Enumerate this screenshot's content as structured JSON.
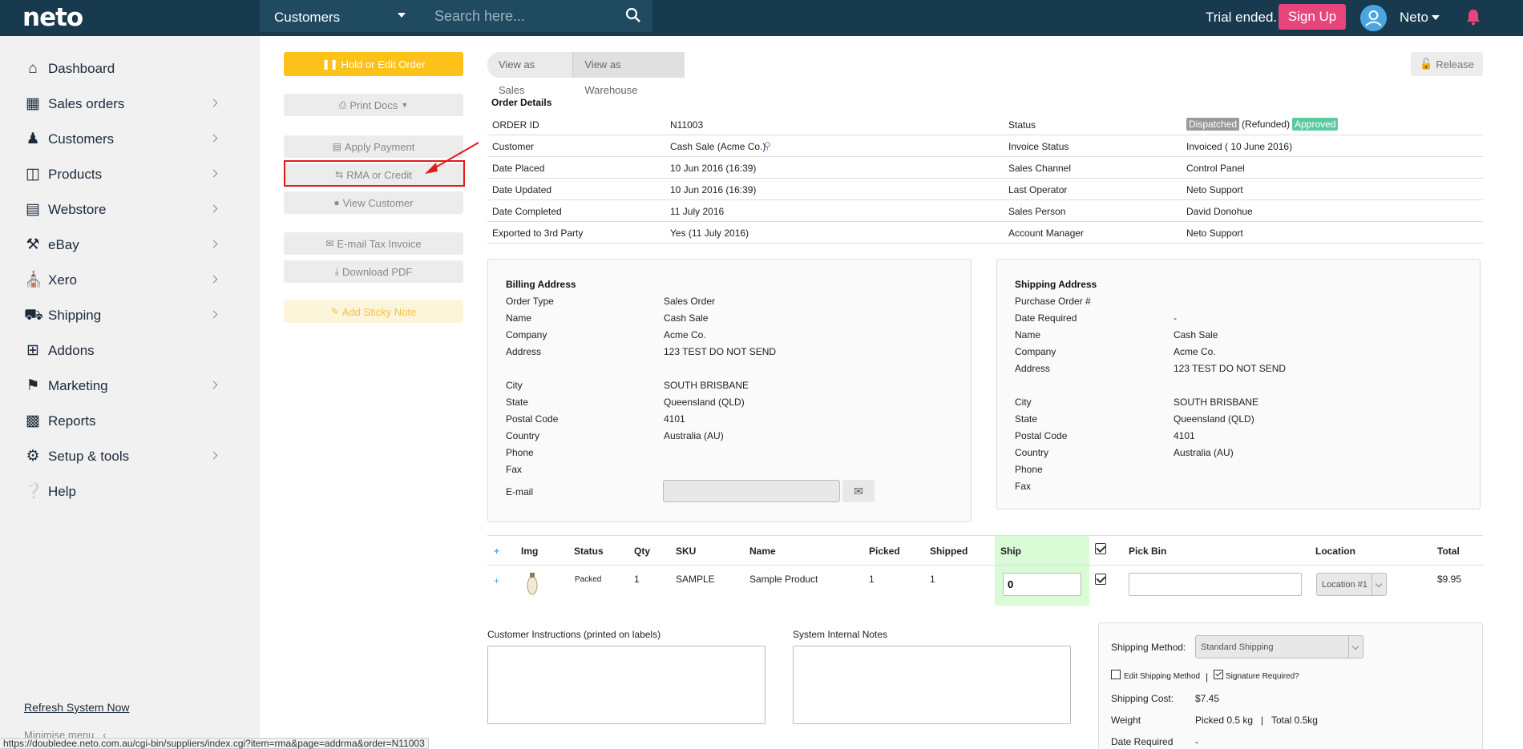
{
  "topbar": {
    "logo": "neto",
    "search_scope": "Customers",
    "search_placeholder": "Search here...",
    "trial": "Trial ended.",
    "signup": "Sign Up",
    "user": "Neto"
  },
  "sidebar": {
    "items": [
      {
        "label": "Dashboard",
        "icon": "home-icon"
      },
      {
        "label": "Sales orders",
        "icon": "document-icon"
      },
      {
        "label": "Customers",
        "icon": "users-icon"
      },
      {
        "label": "Products",
        "icon": "box-icon"
      },
      {
        "label": "Webstore",
        "icon": "browser-icon"
      },
      {
        "label": "eBay",
        "icon": "gavel-icon"
      },
      {
        "label": "Xero",
        "icon": "bank-icon"
      },
      {
        "label": "Shipping",
        "icon": "truck-icon"
      },
      {
        "label": "Addons",
        "icon": "plus-square-icon"
      },
      {
        "label": "Marketing",
        "icon": "tag-icon"
      },
      {
        "label": "Reports",
        "icon": "chart-icon"
      },
      {
        "label": "Setup & tools",
        "icon": "gear-icon"
      },
      {
        "label": "Help",
        "icon": "help-icon"
      }
    ],
    "refresh": "Refresh System Now",
    "minimise": "Minimise menu"
  },
  "status_url": "https://doubledee.neto.com.au/cgi-bin/suppliers/index.cgi?item=rma&page=addrma&order=N11003",
  "actions": {
    "hold": "Hold or Edit Order",
    "print": "Print Docs",
    "apply_payment": "Apply Payment",
    "rma": "RMA or Credit",
    "view_customer": "View Customer",
    "email_invoice": "E-mail Tax Invoice",
    "download_pdf": "Download PDF",
    "sticky": "Add Sticky Note"
  },
  "view_toggle": {
    "sales": "View as Sales",
    "warehouse": "View as Warehouse"
  },
  "release": "Release",
  "order_details": {
    "title": "Order Details",
    "rows": [
      {
        "label": "ORDER ID",
        "value": "N11003",
        "label2": "Status",
        "value2": ""
      },
      {
        "label": "Customer",
        "value": "Cash Sale (Acme Co.)",
        "label2": "Invoice Status",
        "value2": "Invoiced ( 10 June 2016)"
      },
      {
        "label": "Date Placed",
        "value": "10 Jun 2016 (16:39)",
        "label2": "Sales Channel",
        "value2": "Control Panel"
      },
      {
        "label": "Date Updated",
        "value": "10 Jun 2016 (16:39)",
        "label2": "Last Operator",
        "value2": "Neto Support"
      },
      {
        "label": "Date Completed",
        "value": "11 July 2016",
        "label2": "Sales Person",
        "value2": "David Donohue"
      },
      {
        "label": "Exported to 3rd Party",
        "value": "Yes (11 July 2016)",
        "label2": "Account Manager",
        "value2": "Neto Support"
      }
    ],
    "status_badges": {
      "dispatched": "Dispatched",
      "refunded": "(Refunded)",
      "approved": "Approved"
    }
  },
  "billing": {
    "title": "Billing Address",
    "rows": [
      {
        "label": "Order Type",
        "value": "Sales Order"
      },
      {
        "label": "Name",
        "value": "Cash Sale"
      },
      {
        "label": "Company",
        "value": "Acme Co."
      },
      {
        "label": "Address",
        "value": "123 TEST DO NOT SEND"
      },
      {
        "label": "City",
        "value": "SOUTH BRISBANE"
      },
      {
        "label": "State",
        "value": "Queensland (QLD)"
      },
      {
        "label": "Postal Code",
        "value": "4101"
      },
      {
        "label": "Country",
        "value": "Australia (AU)"
      },
      {
        "label": "Phone",
        "value": ""
      },
      {
        "label": "Fax",
        "value": ""
      }
    ],
    "email_label": "E-mail"
  },
  "shipping_addr": {
    "title": "Shipping Address",
    "rows": [
      {
        "label": "Purchase Order #",
        "value": ""
      },
      {
        "label": "Date Required",
        "value": "-"
      },
      {
        "label": "Name",
        "value": "Cash Sale"
      },
      {
        "label": "Company",
        "value": "Acme Co."
      },
      {
        "label": "Address",
        "value": "123 TEST DO NOT SEND"
      },
      {
        "label": "City",
        "value": "SOUTH BRISBANE"
      },
      {
        "label": "State",
        "value": "Queensland (QLD)"
      },
      {
        "label": "Postal Code",
        "value": "4101"
      },
      {
        "label": "Country",
        "value": "Australia (AU)"
      },
      {
        "label": "Phone",
        "value": ""
      },
      {
        "label": "Fax",
        "value": ""
      }
    ]
  },
  "lines": {
    "headers": {
      "add": "+",
      "img": "Img",
      "status": "Status",
      "qty": "Qty",
      "sku": "SKU",
      "name": "Name",
      "picked": "Picked",
      "shipped": "Shipped",
      "ship": "Ship",
      "pickbin": "Pick Bin",
      "location": "Location",
      "total": "Total"
    },
    "row": {
      "add": "+",
      "status": "Packed",
      "qty": "1",
      "sku": "SAMPLE",
      "name": "Sample Product",
      "picked": "1",
      "shipped": "1",
      "ship": "0",
      "location": "Location #1",
      "total": "$9.95"
    }
  },
  "notes": {
    "customer": "Customer Instructions (printed on labels)",
    "internal": "System Internal Notes"
  },
  "shipping_box": {
    "method_label": "Shipping Method:",
    "method_value": "Standard Shipping",
    "edit_method": "Edit Shipping Method",
    "separator": "|",
    "signature": "Signature Required?",
    "cost_label": "Shipping Cost:",
    "cost_value": "$7.45",
    "weight_label": "Weight",
    "weight_value": "Picked 0.5 kg   |   Total 0.5kg",
    "date_label": "Date Required",
    "date_value": "-"
  },
  "colors": {
    "topbar": "#173a4e",
    "accent_yellow": "#fcc21a",
    "signup": "#e8457b",
    "dispatched": "#9a9a9a",
    "approved": "#5ccaa0",
    "rma_outline": "#e01b1b"
  }
}
